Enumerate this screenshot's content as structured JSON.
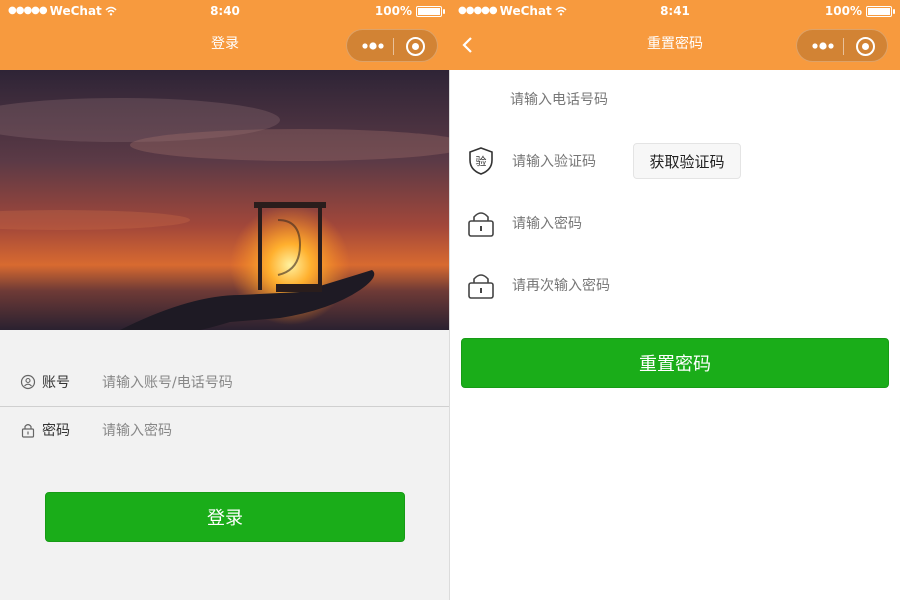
{
  "status_bar": {
    "signal": "●●●●●",
    "carrier": "WeChat",
    "battery_text": "100%"
  },
  "login_screen": {
    "time": "8:40",
    "title": "登录",
    "account_label": "账号",
    "account_placeholder": "请输入账号/电话号码",
    "password_label": "密码",
    "password_placeholder": "请输入密码",
    "login_button": "登录"
  },
  "reset_screen": {
    "time": "8:41",
    "title": "重置密码",
    "phone_placeholder": "请输入电话号码",
    "code_icon_text": "验",
    "code_placeholder": "请输入验证码",
    "get_code_button": "获取验证码",
    "password_placeholder": "请输入密码",
    "confirm_password_placeholder": "请再次输入密码",
    "reset_button": "重置密码"
  },
  "colors": {
    "nav_bar": "#f79a3e",
    "primary_button": "#1aad19",
    "login_background": "#f2f2f2"
  },
  "icons": [
    "more-dots-icon",
    "capsule-close-icon",
    "back-arrow-icon",
    "user-icon",
    "lock-icon",
    "shield-icon",
    "padlock-icon",
    "wifi-icon",
    "battery-icon"
  ]
}
